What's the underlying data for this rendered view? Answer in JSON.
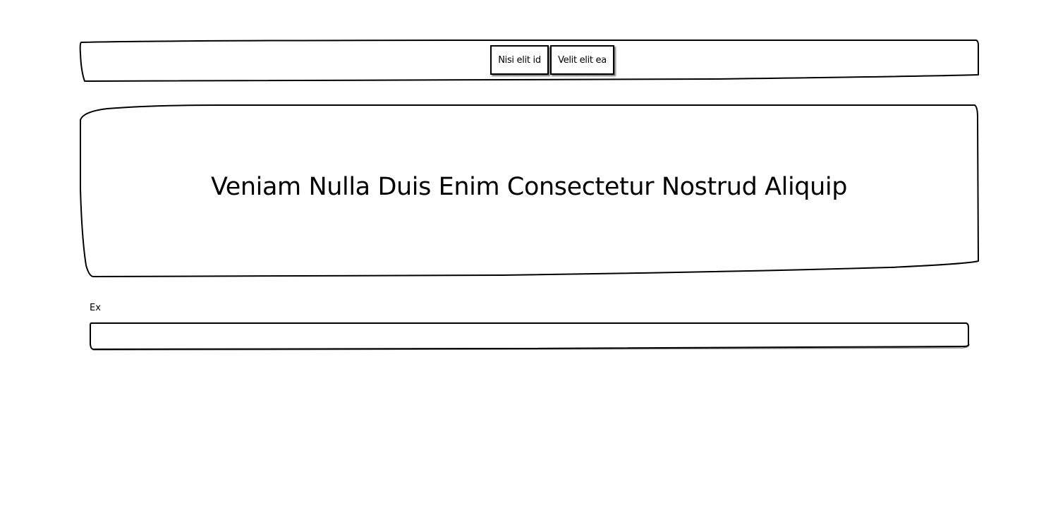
{
  "navbar": {
    "buttons": [
      {
        "label": "Nisi elit id"
      },
      {
        "label": "Velit elit ea"
      }
    ]
  },
  "hero": {
    "title": "Veniam Nulla Duis Enim Consectetur Nostrud Aliquip"
  },
  "form": {
    "field_label": "Ex",
    "field_value": "",
    "field_placeholder": ""
  }
}
